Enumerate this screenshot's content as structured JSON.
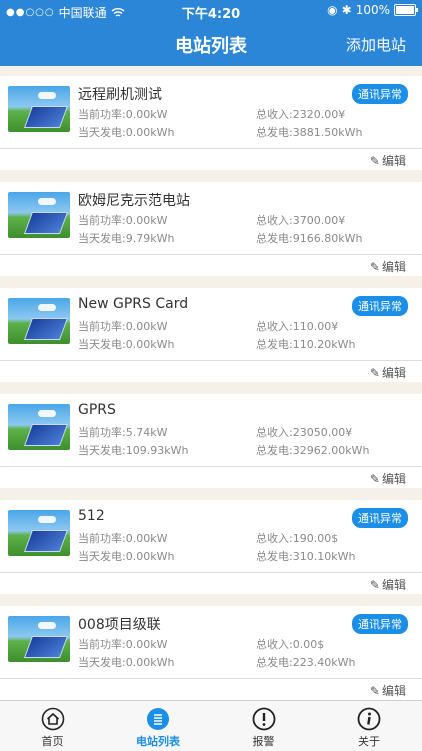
{
  "status_bar": {
    "carrier": "中国联通",
    "time": "下午4:20",
    "battery": "100%",
    "battery_level": 1.0
  },
  "nav": {
    "title": "电站列表",
    "add_label": "添加电站"
  },
  "stations": [
    {
      "name": "远程刷机测试",
      "badge": "通讯异常",
      "power": "当前功率:0.00kW",
      "income": "总收入:2320.00¥",
      "today": "当天发电:0.00kWh",
      "total": "总发电:3881.50kWh",
      "edit": "编辑"
    },
    {
      "name": "欧姆尼克示范电站",
      "badge": "",
      "power": "当前功率:0.00kW",
      "income": "总收入:3700.00¥",
      "today": "当天发电:9.79kWh",
      "total": "总发电:9166.80kWh",
      "edit": "编辑"
    },
    {
      "name": "New GPRS Card",
      "badge": "通讯异常",
      "power": "当前功率:0.00kW",
      "income": "总收入:110.00¥",
      "today": "当天发电:0.00kWh",
      "total": "总发电:110.20kWh",
      "edit": "编辑"
    },
    {
      "name": " GPRS",
      "badge": "",
      "power": "当前功率:5.74kW",
      "income": "总收入:23050.00¥",
      "today": "当天发电:109.93kWh",
      "total": "总发电:32962.00kWh",
      "edit": "编辑"
    },
    {
      "name": "512",
      "badge": "通讯异常",
      "power": "当前功率:0.00kW",
      "income": "总收入:190.00$",
      "today": "当天发电:0.00kWh",
      "total": "总发电:310.10kWh",
      "edit": "编辑"
    },
    {
      "name": "008项目级联",
      "badge": "通讯异常",
      "power": "当前功率:0.00kW",
      "income": "总收入:0.00$",
      "today": "当天发电:0.00kWh",
      "total": "总发电:223.40kWh",
      "edit": "编辑"
    }
  ],
  "tabs": [
    {
      "label": "首页",
      "icon": "home-icon"
    },
    {
      "label": "电站列表",
      "icon": "list-icon",
      "active": true
    },
    {
      "label": "报警",
      "icon": "alarm-icon"
    },
    {
      "label": "关于",
      "icon": "info-icon"
    }
  ],
  "colors": {
    "accent": "#2b86d8",
    "badge": "#1b8ee8"
  }
}
